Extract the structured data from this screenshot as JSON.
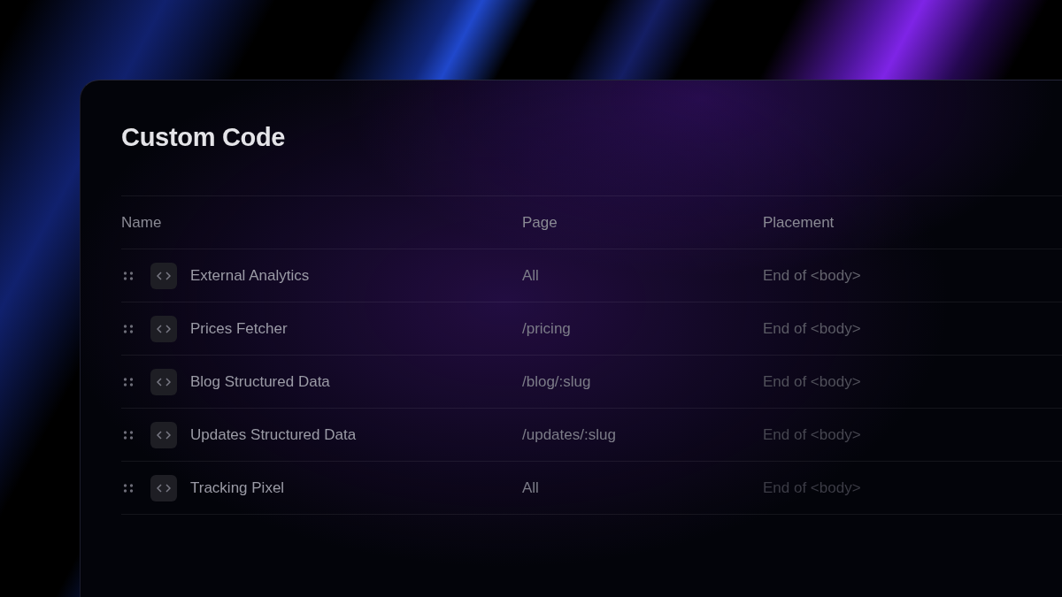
{
  "panel": {
    "title": "Custom Code"
  },
  "table": {
    "columns": [
      "Name",
      "Page",
      "Placement"
    ],
    "rows": [
      {
        "name": "External Analytics",
        "page": "All",
        "placement": "End of <body>"
      },
      {
        "name": "Prices Fetcher",
        "page": "/pricing",
        "placement": "End of <body>"
      },
      {
        "name": "Blog Structured Data",
        "page": "/blog/:slug",
        "placement": "End of <body>"
      },
      {
        "name": "Updates Structured Data",
        "page": "/updates/:slug",
        "placement": "End of <body>"
      },
      {
        "name": "Tracking Pixel",
        "page": "All",
        "placement": "End of <body>"
      }
    ]
  }
}
